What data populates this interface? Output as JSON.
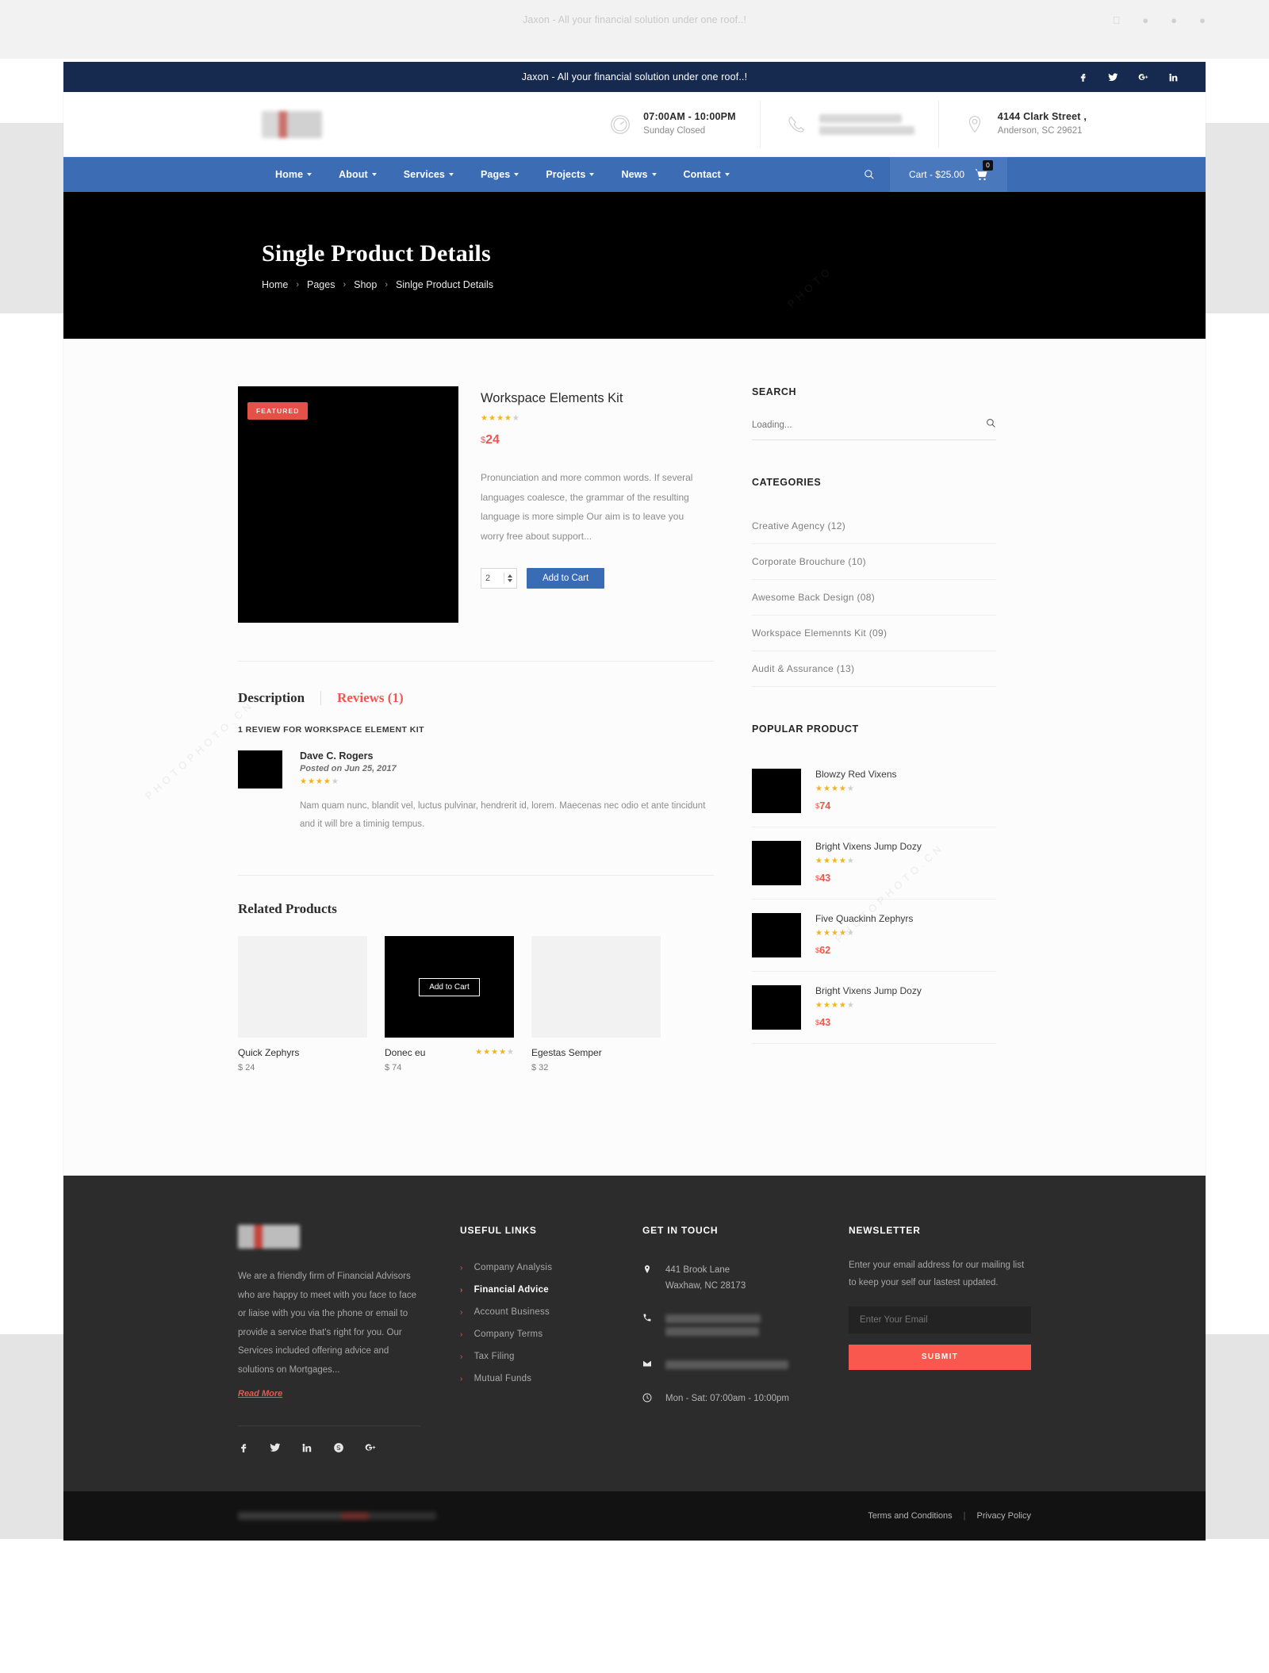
{
  "browser": {
    "ghost_title": "Jaxon - All your financial solution under one roof..!"
  },
  "topbar": {
    "tagline": "Jaxon - All your financial solution under one roof..!",
    "socials": [
      "facebook-icon",
      "twitter-icon",
      "google-plus-icon",
      "linkedin-icon"
    ]
  },
  "header": {
    "logo_alt": "site-logo",
    "hours": {
      "primary": "07:00AM - 10:00PM",
      "secondary": "Sunday Closed"
    },
    "phone": {
      "primary": "",
      "secondary": ""
    },
    "address": {
      "primary": "4144 Clark Street ,",
      "secondary": "Anderson, SC 29621"
    }
  },
  "nav": {
    "items": [
      {
        "label": "Home",
        "caret": true
      },
      {
        "label": "About",
        "caret": true
      },
      {
        "label": "Services",
        "caret": true
      },
      {
        "label": "Pages",
        "caret": true
      },
      {
        "label": "Projects",
        "caret": true
      },
      {
        "label": "News",
        "caret": true
      },
      {
        "label": "Contact",
        "caret": true
      }
    ],
    "cart_label": "Cart - $25.00",
    "cart_count": "0"
  },
  "hero": {
    "title": "Single Product Details",
    "breadcrumb": [
      "Home",
      "Pages",
      "Shop",
      "Sinlge Product Details"
    ],
    "separator": "›"
  },
  "product": {
    "badge": "FEATURED",
    "name": "Workspace Elements Kit",
    "rating": 4,
    "rating_max": 5,
    "currency": "$",
    "price": "24",
    "description": "Pronunciation and more common words. If several languages coalesce, the grammar of the resulting language is more simple Our aim is to leave you worry free about  support...",
    "quantity": "2",
    "add_to_cart": "Add to Cart"
  },
  "tabs": {
    "description": "Description",
    "reviews": "Reviews (1)",
    "active": "reviews"
  },
  "reviews": {
    "heading": "1 REVIEW FOR WORKSPACE ELEMENT KIT",
    "items": [
      {
        "author": "Dave C. Rogers",
        "date": "Posted on Jun 25, 2017",
        "rating": 4,
        "text": "Nam quam nunc, blandit vel, luctus pulvinar, hendrerit id, lorem. Maecenas nec odio et ante tincidunt and it will bre a timinig tempus."
      }
    ]
  },
  "related": {
    "title": "Related Products",
    "add_to_cart": "Add to Cart",
    "items": [
      {
        "name": "Quick Zephyrs",
        "price": "$ 24",
        "dark": false,
        "rating": 0
      },
      {
        "name": "Donec eu",
        "price": "$ 74",
        "dark": true,
        "rating": 4
      },
      {
        "name": "Egestas Semper",
        "price": "$ 32",
        "dark": false,
        "rating": 0
      }
    ]
  },
  "sidebar": {
    "search": {
      "title": "SEARCH",
      "placeholder": "Loading...",
      "value": ""
    },
    "categories": {
      "title": "CATEGORIES",
      "items": [
        "Creative Agency (12)",
        "Corporate Brouchure (10)",
        "Awesome Back Design (08)",
        "Workspace Elemennts Kit (09)",
        "Audit & Assurance (13)"
      ]
    },
    "popular": {
      "title": "POPULAR PRODUCT",
      "items": [
        {
          "name": "Blowzy Red Vixens",
          "price": "74",
          "currency": "$",
          "rating": 4
        },
        {
          "name": "Bright Vixens Jump Dozy",
          "price": "43",
          "currency": "$",
          "rating": 4
        },
        {
          "name": "Five Quackinh Zephyrs",
          "price": "62",
          "currency": "$",
          "rating": 4
        },
        {
          "name": "Bright Vixens Jump Dozy",
          "price": "43",
          "currency": "$",
          "rating": 4
        }
      ]
    }
  },
  "footer": {
    "about": {
      "text": "We are a friendly firm of Financial Advisors who are happy to meet with you face to face or liaise with you via the phone or email to provide a service that's right for you. Our Services included offering advice and solutions on Mortgages...",
      "read_more": "Read More",
      "socials": [
        "facebook-icon",
        "twitter-icon",
        "linkedin-icon",
        "skype-icon",
        "google-plus-icon"
      ]
    },
    "useful_links": {
      "title": "USEFUL LINKS",
      "items": [
        {
          "label": "Company Analysis",
          "active": false
        },
        {
          "label": "Financial Advice",
          "active": true
        },
        {
          "label": "Account Business",
          "active": false
        },
        {
          "label": "Company Terms",
          "active": false
        },
        {
          "label": "Tax Filing",
          "active": false
        },
        {
          "label": "Mutual Funds",
          "active": false
        }
      ]
    },
    "contact": {
      "title": "GET IN TOUCH",
      "address_line1": "441 Brook Lane",
      "address_line2": "Waxhaw, NC 28173",
      "hours": "Mon - Sat: 07:00am - 10:00pm"
    },
    "newsletter": {
      "title": "NEWSLETTER",
      "text": "Enter your email address for our mailing list to keep your self our lastest updated.",
      "placeholder": "Enter Your Email",
      "submit": "SUBMIT"
    },
    "bottom": {
      "terms": "Terms and Conditions",
      "privacy": "Privacy Policy",
      "pipe": "|"
    }
  },
  "colors": {
    "topbar": "#16294f",
    "nav": "#3b6cb4",
    "accent_red": "#f0564c",
    "star": "#f5b31b",
    "footer": "#2c2c2c"
  }
}
